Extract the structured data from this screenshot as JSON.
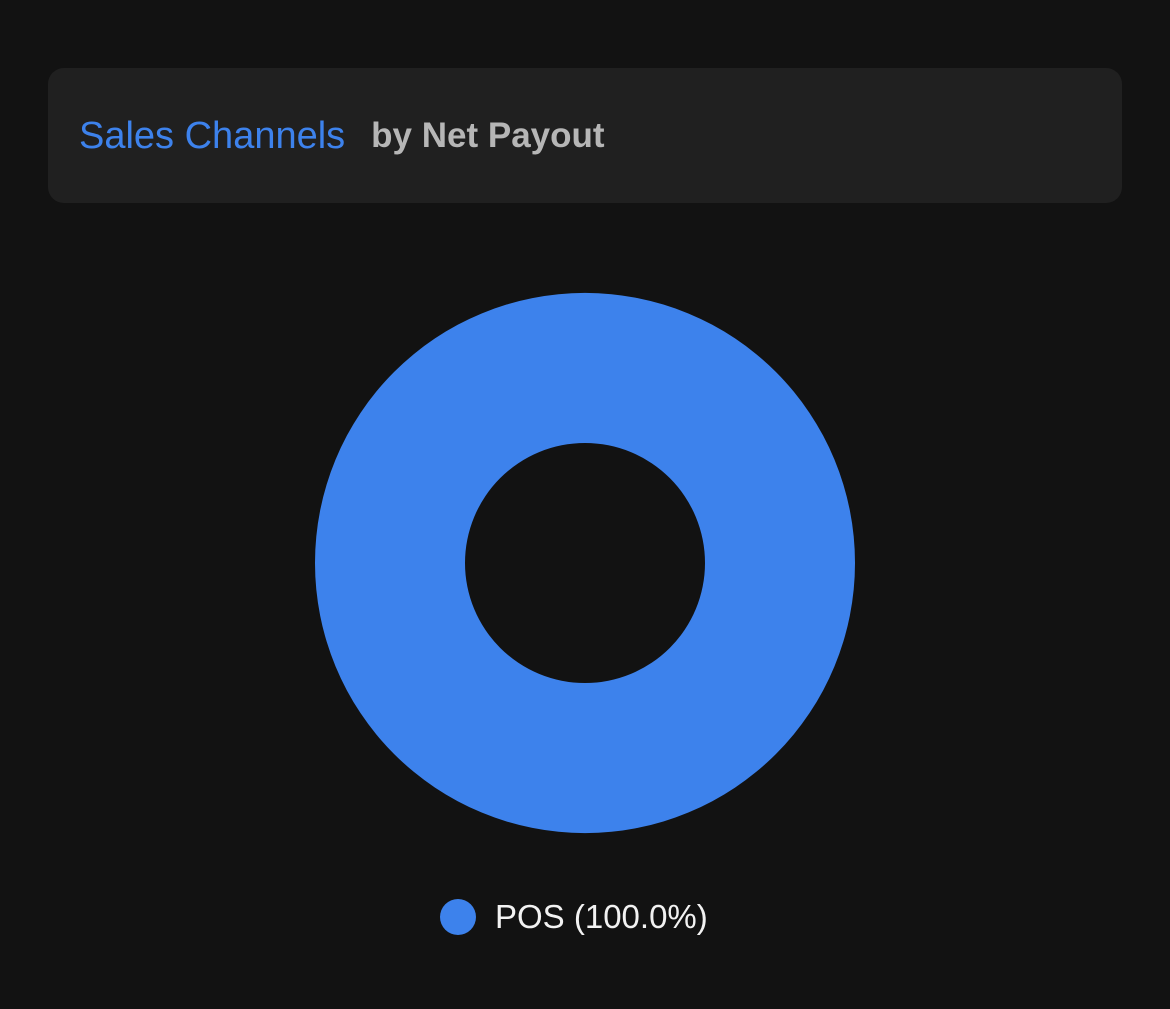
{
  "header": {
    "title": "Sales Channels",
    "subtitle": "by Net Payout"
  },
  "colors": {
    "background": "#121212",
    "card": "#202020",
    "title": "#3d82ec",
    "subtitle": "#b6b6b6",
    "legend_text": "#f2f2f2"
  },
  "chart_data": {
    "type": "pie",
    "variant": "donut",
    "title": "Sales Channels",
    "subtitle": "by Net Payout",
    "slices": [
      {
        "label": "POS",
        "value": 100.0,
        "color": "#3d82ec",
        "legend_text": "POS (100.0%)"
      }
    ],
    "legend_position": "bottom"
  }
}
